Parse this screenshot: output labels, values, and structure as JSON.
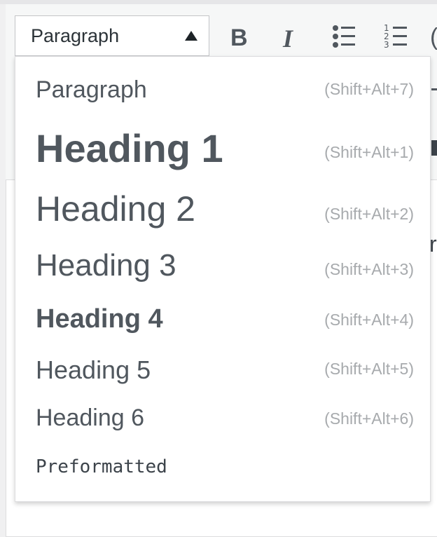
{
  "format_select": {
    "selected": "Paragraph"
  },
  "toolbar": {
    "bold_glyph": "B",
    "italic_glyph": "I",
    "more_glyph": "("
  },
  "editor_peek": {
    "letter": "r"
  },
  "format_menu": {
    "items": [
      {
        "label": "Paragraph",
        "shortcut": "(Shift+Alt+7)"
      },
      {
        "label": "Heading 1",
        "shortcut": "(Shift+Alt+1)"
      },
      {
        "label": "Heading 2",
        "shortcut": "(Shift+Alt+2)"
      },
      {
        "label": "Heading 3",
        "shortcut": "(Shift+Alt+3)"
      },
      {
        "label": "Heading 4",
        "shortcut": "(Shift+Alt+4)"
      },
      {
        "label": "Heading 5",
        "shortcut": "(Shift+Alt+5)"
      },
      {
        "label": "Heading 6",
        "shortcut": "(Shift+Alt+6)"
      },
      {
        "label": "Preformatted",
        "shortcut": ""
      }
    ]
  },
  "colors": {
    "menu_text": "#50575e",
    "shortcut_text": "#a7aaad",
    "border": "#dcdcde"
  }
}
